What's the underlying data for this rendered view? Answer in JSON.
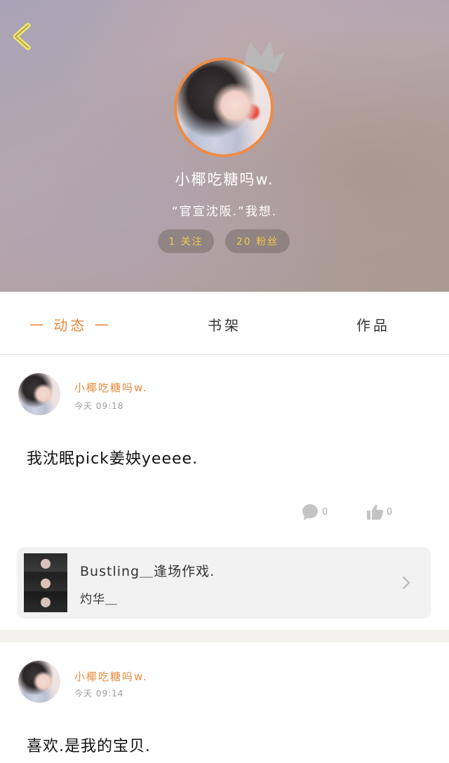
{
  "header": {
    "username": "小椰吃糖吗w.",
    "motto": "“官宣沈阪.”我想.",
    "following_label": "1 关注",
    "fans_label": "20 粉丝"
  },
  "tabs": {
    "active": "一 动态 一",
    "shelf": "书架",
    "works": "作品"
  },
  "posts": [
    {
      "author": "小椰吃糖吗w.",
      "time": "今天 09:18",
      "text": "我沈眠pick姜姎yeeee.",
      "comments": "0",
      "likes": "0",
      "share": {
        "title": "Bustling＿逢场作戏.",
        "subtitle": "灼华＿"
      }
    },
    {
      "author": "小椰吃糖吗w.",
      "time": "今天 09:14",
      "text": "喜欢.是我的宝贝."
    }
  ],
  "colors": {
    "accent": "#e58a3b",
    "gold": "#f2c94c",
    "avatar_border": "#ef8b45"
  }
}
